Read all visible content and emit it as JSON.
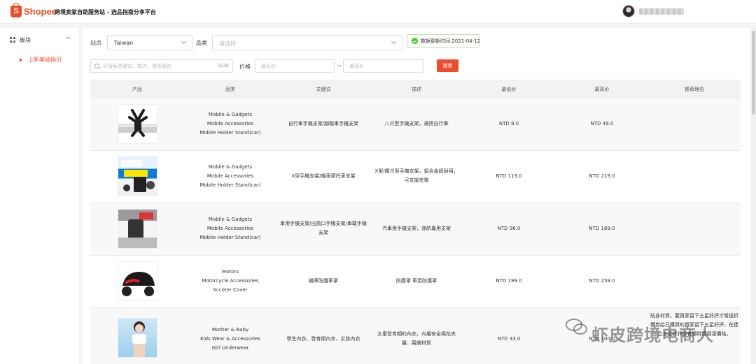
{
  "header": {
    "brand_mark": "S",
    "brand": "Shopee",
    "site_title": "跨境卖家自助服务站 - 选品指南分享平台"
  },
  "sidebar": {
    "section_label": "板块",
    "items": [
      {
        "label": "上新基础指引"
      }
    ]
  },
  "filters": {
    "site_label": "站点",
    "site_value": "Taiwan",
    "category_label": "品类",
    "category_placeholder": "请选择",
    "update_text": "数据更新时间:2021-04-12",
    "keyword_placeholder": "可搜索关键词、描述、推荐理由",
    "keyword_counter": "0/30",
    "price_label": "价格",
    "min_price_placeholder": "最低价",
    "tilde": "~",
    "max_price_placeholder": "最高价",
    "search_button": "搜索"
  },
  "table": {
    "headers": [
      "产品",
      "品类",
      "关键词",
      "描述",
      "最低价",
      "最高价",
      "推荐理由"
    ],
    "rows": [
      {
        "category": [
          "Mobile & Gadgets",
          "Mobile Accessories",
          "Mobile Holder Stand(car)"
        ],
        "keywords": "自行車手機支架/腳踏車手機支架",
        "description": "八爪型手機支架，適用自行車",
        "min_price": "NTD 9.0",
        "max_price": "NTD 49.0",
        "reason": ""
      },
      {
        "category": [
          "Mobile & Gadgets",
          "Mobile Accessories",
          "Mobile Holder Stand(car)"
        ],
        "keywords": "X型手機支架/機車摩托車支架",
        "description": "X型/鷹爪型手機支架，鋁合金超耐用，可支援充電",
        "min_price": "NTD 119.0",
        "max_price": "NTD 219.0",
        "reason": ""
      },
      {
        "category": [
          "Mobile & Gadgets",
          "Mobile Accessories",
          "Mobile Holder Stand(car)"
        ],
        "keywords": "車用手機支架/出風口手機支架/車載手機支架",
        "description": "汽車用手機支架，導航專用支架",
        "min_price": "NTD 96.0",
        "max_price": "NTD 169.0",
        "reason": ""
      },
      {
        "category": [
          "Motors",
          "Motorcycle Accessories",
          "Sccoter Cover"
        ],
        "keywords": "機車防護車罩",
        "description": "防塵罩 車用防護罩",
        "min_price": "NTD 199.0",
        "max_price": "NTD 259.0",
        "reason": ""
      },
      {
        "category": [
          "Mother & Baby",
          "Kids Wear & Accessories",
          "Girl Underwear"
        ],
        "keywords": "學生內衣、發育期內衣、女孩內衣",
        "description": "女童發育期的內衣，內層安全棉花夾層，親膚材質",
        "min_price": "NTD 33.0",
        "max_price": "NTD 100.0",
        "reason": "貼身材質，要買家留下五星好評才贈送折價券給已購買的買家留下五星好評，在建立五星好評後會隨時間調漲價格。"
      }
    ]
  },
  "watermark": "虾皮跨境电商人",
  "colors": {
    "accent": "#ee4d2d",
    "success": "#52c41a"
  }
}
